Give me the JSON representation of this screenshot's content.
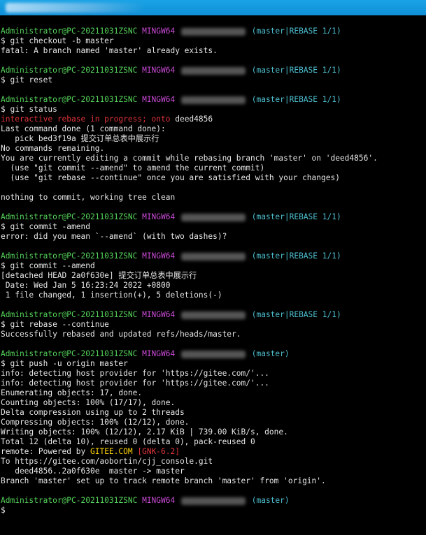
{
  "window": {
    "title_obscured": true
  },
  "prompt": {
    "user_host": "Administrator@PC-20211031ZSNC",
    "shell": "MINGW64",
    "branch_rebase": "(master|REBASE 1/1)",
    "branch": "(master)",
    "symbol": "$"
  },
  "blocks": [
    {
      "command": "$ git checkout -b master",
      "output": [
        {
          "text": "fatal: A branch named 'master' already exists.",
          "color": "white"
        }
      ]
    },
    {
      "command": "$ git reset",
      "output": []
    },
    {
      "command": "$ git status",
      "output": [
        {
          "text": "interactive rebase in progress; onto ",
          "color": "red",
          "suffix": "deed4856"
        },
        {
          "text": "Last command done (1 command done):",
          "color": "white"
        },
        {
          "text": "   pick bed3f19a 提交订单总表中展示行",
          "color": "white"
        },
        {
          "text": "No commands remaining.",
          "color": "white"
        },
        {
          "text": "You are currently editing a commit while rebasing branch 'master' on 'deed4856'.",
          "color": "white"
        },
        {
          "text": "  (use \"git commit --amend\" to amend the current commit)",
          "color": "white"
        },
        {
          "text": "  (use \"git rebase --continue\" once you are satisfied with your changes)",
          "color": "white"
        },
        {
          "text": "",
          "color": "white"
        },
        {
          "text": "nothing to commit, working tree clean",
          "color": "white"
        }
      ]
    },
    {
      "command": "$ git commit -amend",
      "output": [
        {
          "text": "error: did you mean `--amend` (with two dashes)?",
          "color": "white"
        }
      ]
    },
    {
      "command": "$ git commit --amend",
      "output": [
        {
          "text": "[detached HEAD 2a0f630e] 提交订单总表中展示行",
          "color": "white"
        },
        {
          "text": " Date: Wed Jan 5 16:23:24 2022 +0800",
          "color": "white"
        },
        {
          "text": " 1 file changed, 1 insertion(+), 5 deletions(-)",
          "color": "white"
        }
      ]
    },
    {
      "command": "$ git rebase --continue",
      "output": [
        {
          "text": "Successfully rebased and updated refs/heads/master.",
          "color": "white"
        }
      ]
    }
  ],
  "push_block": {
    "command": "$ git push -u origin master",
    "lines": [
      "info: detecting host provider for 'https://gitee.com/'...",
      "info: detecting host provider for 'https://gitee.com/'...",
      "Enumerating objects: 17, done.",
      "Counting objects: 100% (17/17), done.",
      "Delta compression using up to 2 threads",
      "Compressing objects: 100% (12/12), done.",
      "Writing objects: 100% (12/12), 2.17 KiB | 739.00 KiB/s, done.",
      "Total 12 (delta 10), reused 0 (delta 0), pack-reused 0"
    ],
    "remote_prefix": "remote: Powered by ",
    "remote_gitee": "GITEE.COM",
    "remote_version": "[GNK-6.2]",
    "after_lines": [
      "To https://gitee.com/aobortin/cjj_console.git",
      "   deed4856..2a0f630e  master -> master",
      "Branch 'master' set up to track remote branch 'master' from 'origin'."
    ]
  },
  "final_symbol": "$",
  "colors": {
    "green": "#55d45a",
    "magenta": "#c84ad4",
    "yellow": "#ffd400",
    "cyan": "#4dbfcf",
    "red": "#e0343a",
    "background": "#000000",
    "titlebar": "#1296dc"
  }
}
